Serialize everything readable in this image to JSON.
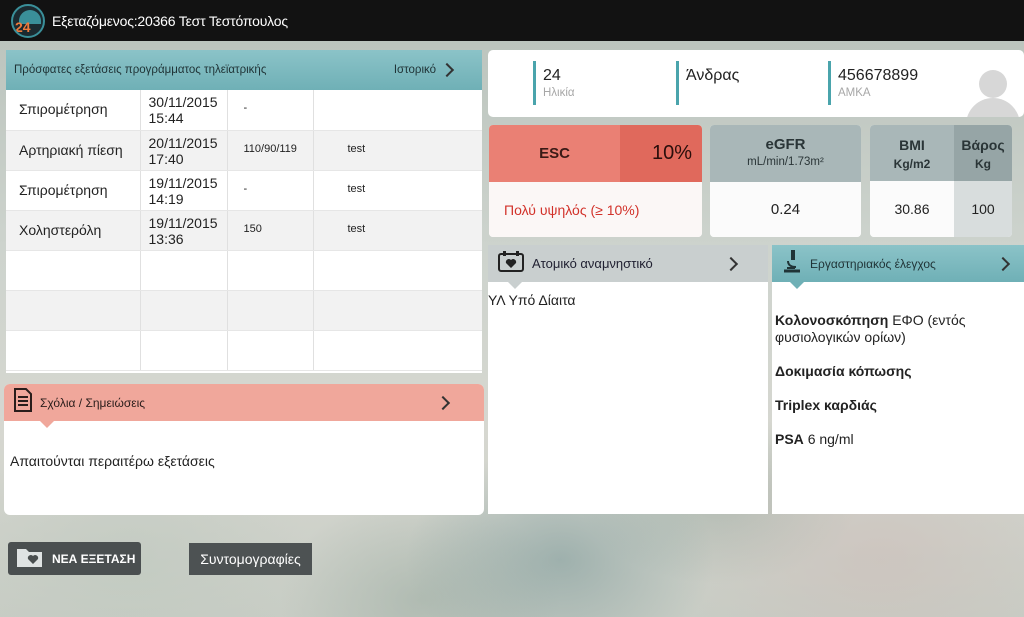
{
  "app": {
    "logo_text": "24",
    "title": "Εξεταζόμενος:20366 Τεστ Τεστόπουλος"
  },
  "history": {
    "title": "Πρόσφατες εξετάσεις προγράμματος τηλεϊατρικής",
    "more_label": "Ιστορικό",
    "rows": [
      {
        "exam": "Σπιρομέτρηση",
        "date": "30/11/2015",
        "time": "15:44",
        "value": "-",
        "note": ""
      },
      {
        "exam": "Αρτηριακή πίεση",
        "date": "20/11/2015",
        "time": "17:40",
        "value": "110/90/119",
        "note": "test"
      },
      {
        "exam": "Σπιρομέτρηση",
        "date": "19/11/2015",
        "time": "14:19",
        "value": "-",
        "note": "test"
      },
      {
        "exam": "Χοληστερόλη",
        "date": "19/11/2015",
        "time": "13:36",
        "value": "150",
        "note": "test"
      }
    ]
  },
  "comments": {
    "title": "Σχόλια / Σημειώσεις",
    "text": "Απαιτούνται περαιτέρω εξετάσεις"
  },
  "patient": {
    "age_value": "24",
    "age_label": "Ηλικία",
    "sex_value": "Άνδρας",
    "amka_value": "456678899",
    "amka_label": "ΑΜΚΑ"
  },
  "esc": {
    "label": "ESC",
    "value": "10%",
    "risk_text": "Πολύ υψηλός (≥ 10%)"
  },
  "egfr": {
    "label": "eGFR",
    "unit": "mL/min/1.73m²",
    "value": "0.24"
  },
  "bmi": {
    "label": "BMI",
    "unit": "Kg/m2",
    "value": "30.86"
  },
  "weight": {
    "label": "Βάρος",
    "unit": "Kg",
    "value": "100"
  },
  "anamnesis": {
    "title": "Ατομικό αναμνηστικό",
    "text": "ΥΛ Υπό Δίαιτα"
  },
  "lab": {
    "title": "Εργαστηριακός έλεγχος",
    "items": [
      {
        "name": "Κολονοσκόπηση",
        "detail": "ΕΦΟ (εντός φυσιολογικών ορίων)"
      },
      {
        "name": "Δοκιμασία κόπωσης",
        "detail": ""
      },
      {
        "name": "Triplex καρδιάς",
        "detail": ""
      },
      {
        "name": "PSA",
        "detail": "6 ng/ml"
      }
    ]
  },
  "actions": {
    "new_exam": "ΝΕΑ ΕΞΕΤΑΣΗ",
    "shortcuts": "Συντομογραφίες"
  },
  "colors": {
    "teal": "#6fb0b6",
    "salmon": "#f0a79b",
    "esc_red": "#e0695c",
    "risk_text": "#d2322a"
  }
}
